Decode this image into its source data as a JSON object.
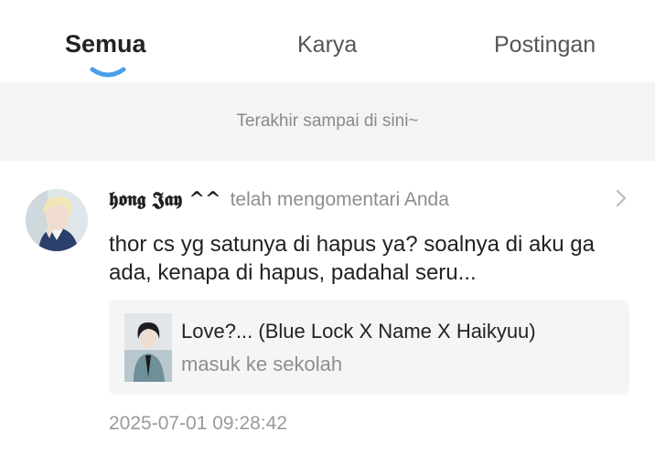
{
  "tabs": [
    {
      "label": "Semua",
      "active": true
    },
    {
      "label": "Karya",
      "active": false
    },
    {
      "label": "Postingan",
      "active": false
    }
  ],
  "accent_color": "#4a9fe8",
  "end_banner": {
    "text": "Terakhir sampai di sini~"
  },
  "notification": {
    "username": "𝖍𝖔𝖓𝖌 𝕵𝖆𝖞 ^^",
    "action": "telah mengomentari Anda",
    "comment": "thor cs yg satunya di hapus ya? soalnya di aku ga ada, kenapa di hapus, padahal seru...",
    "story": {
      "title": "Love?... (Blue Lock X Name X Haikyuu)",
      "subtitle": "masuk ke sekolah"
    },
    "timestamp": "2025-07-01 09:28:42",
    "icons": {
      "avatar": "user-avatar",
      "chevron": "chevron-right-icon",
      "cover": "story-cover"
    }
  }
}
